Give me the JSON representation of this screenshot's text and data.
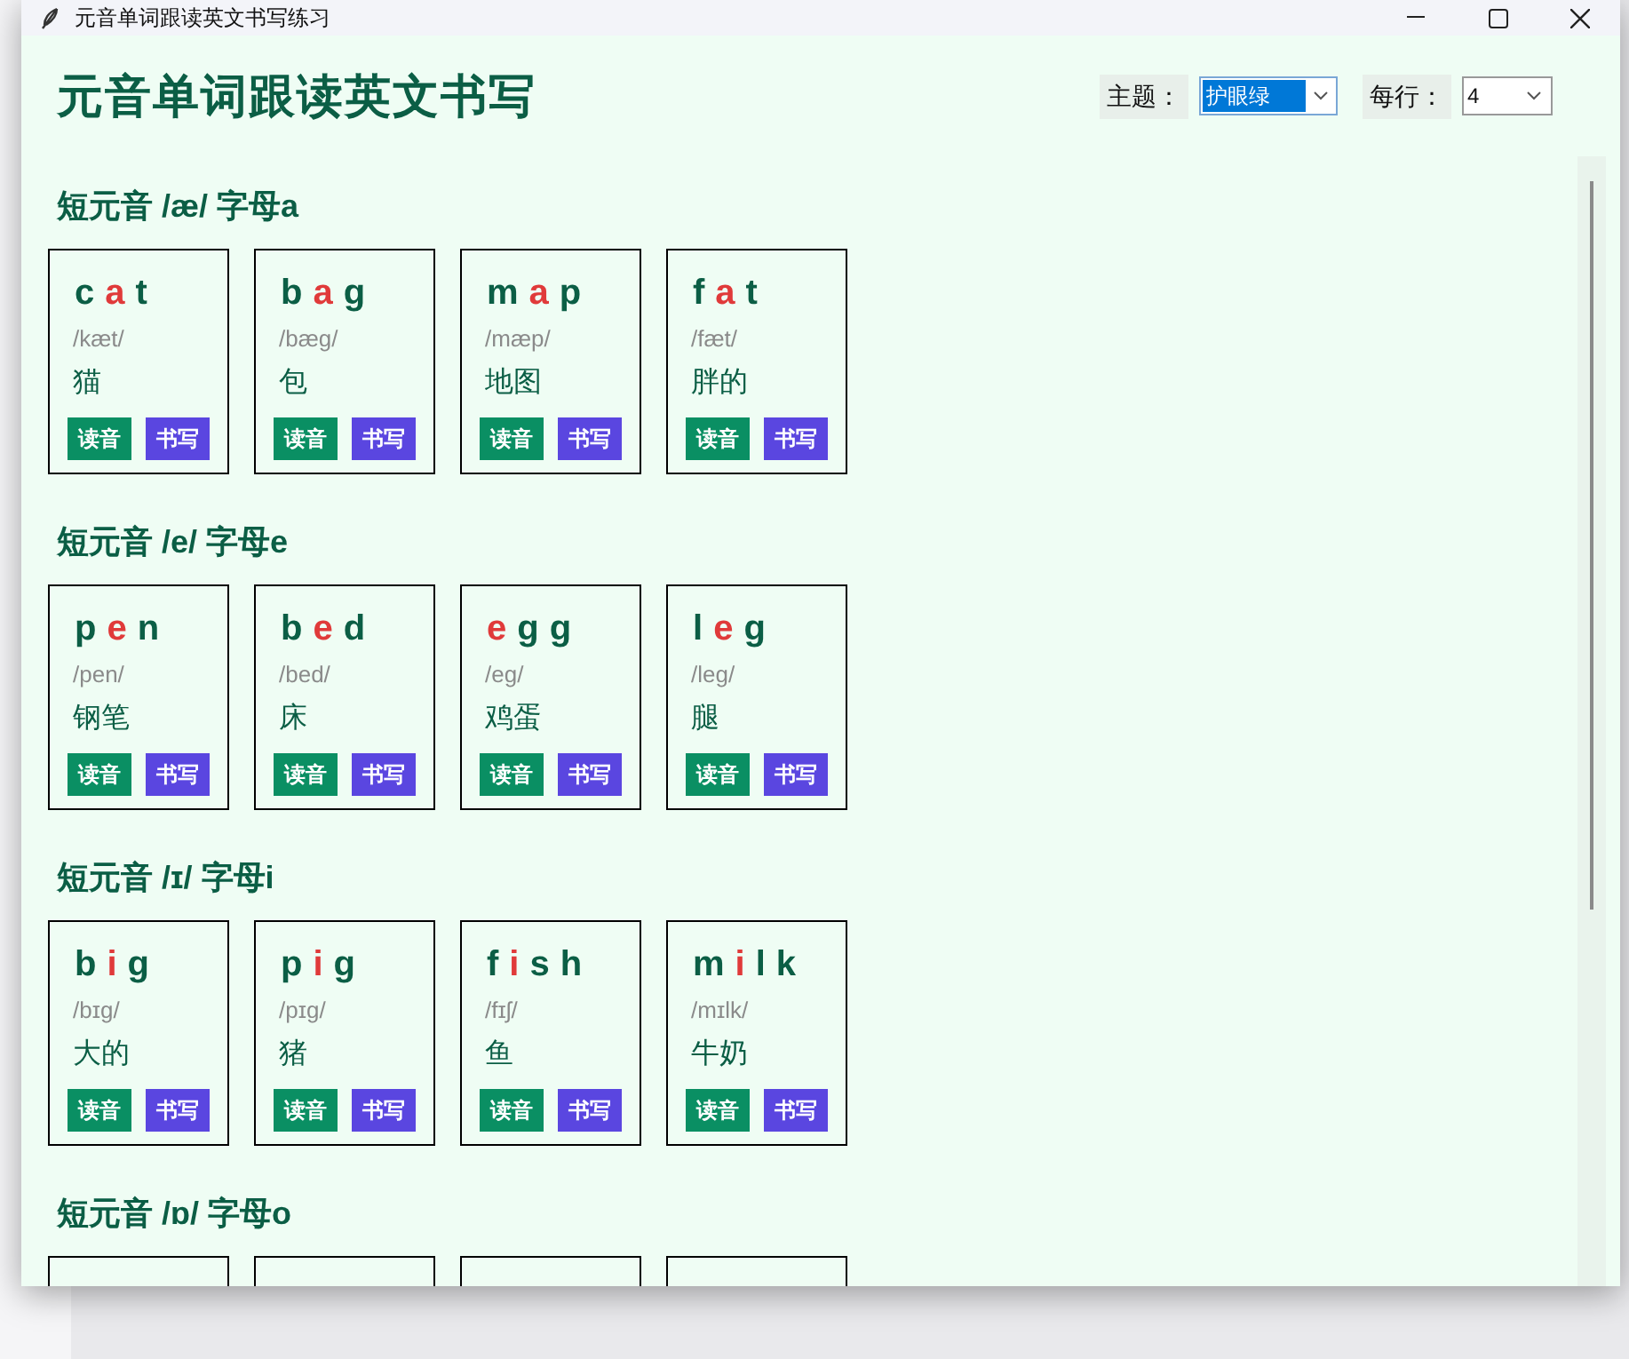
{
  "window": {
    "title": "元音单词跟读英文书写练习"
  },
  "heading": "元音单词跟读英文书写",
  "controls": {
    "theme_label": "主题：",
    "theme_value": "护眼绿",
    "per_row_label": "每行：",
    "per_row_value": "4"
  },
  "sections": [
    {
      "title": "短元音 /æ/ 字母a",
      "cards": [
        {
          "kind": "word",
          "letters": [
            {
              "char": "c",
              "vowel": false
            },
            {
              "char": "a",
              "vowel": true
            },
            {
              "char": "t",
              "vowel": false
            }
          ],
          "phonetic": "/kæt/",
          "meaning": "猫",
          "read_button": "读音",
          "write_button": "书写"
        },
        {
          "kind": "word",
          "letters": [
            {
              "char": "b",
              "vowel": false
            },
            {
              "char": "a",
              "vowel": true
            },
            {
              "char": "g",
              "vowel": false
            }
          ],
          "phonetic": "/bæg/",
          "meaning": "包",
          "read_button": "读音",
          "write_button": "书写"
        },
        {
          "kind": "word",
          "letters": [
            {
              "char": "m",
              "vowel": false
            },
            {
              "char": "a",
              "vowel": true
            },
            {
              "char": "p",
              "vowel": false
            }
          ],
          "phonetic": "/mæp/",
          "meaning": "地图",
          "read_button": "读音",
          "write_button": "书写"
        },
        {
          "kind": "word",
          "letters": [
            {
              "char": "f",
              "vowel": false
            },
            {
              "char": "a",
              "vowel": true
            },
            {
              "char": "t",
              "vowel": false
            }
          ],
          "phonetic": "/fæt/",
          "meaning": "胖的",
          "read_button": "读音",
          "write_button": "书写"
        }
      ]
    },
    {
      "title": "短元音 /e/ 字母e",
      "cards": [
        {
          "kind": "word",
          "letters": [
            {
              "char": "p",
              "vowel": false
            },
            {
              "char": "e",
              "vowel": true
            },
            {
              "char": "n",
              "vowel": false
            }
          ],
          "phonetic": "/pen/",
          "meaning": "钢笔",
          "read_button": "读音",
          "write_button": "书写"
        },
        {
          "kind": "word",
          "letters": [
            {
              "char": "b",
              "vowel": false
            },
            {
              "char": "e",
              "vowel": true
            },
            {
              "char": "d",
              "vowel": false
            }
          ],
          "phonetic": "/bed/",
          "meaning": "床",
          "read_button": "读音",
          "write_button": "书写"
        },
        {
          "kind": "word",
          "letters": [
            {
              "char": "e",
              "vowel": true
            },
            {
              "char": "g",
              "vowel": false
            },
            {
              "char": "g",
              "vowel": false
            }
          ],
          "phonetic": "/eg/",
          "meaning": "鸡蛋",
          "read_button": "读音",
          "write_button": "书写"
        },
        {
          "kind": "word",
          "letters": [
            {
              "char": "l",
              "vowel": false
            },
            {
              "char": "e",
              "vowel": true
            },
            {
              "char": "g",
              "vowel": false
            }
          ],
          "phonetic": "/leg/",
          "meaning": "腿",
          "read_button": "读音",
          "write_button": "书写"
        }
      ]
    },
    {
      "title": "短元音 /ɪ/ 字母i",
      "cards": [
        {
          "kind": "word",
          "letters": [
            {
              "char": "b",
              "vowel": false
            },
            {
              "char": "i",
              "vowel": true
            },
            {
              "char": "g",
              "vowel": false
            }
          ],
          "phonetic": "/bɪg/",
          "meaning": "大的",
          "read_button": "读音",
          "write_button": "书写"
        },
        {
          "kind": "word",
          "letters": [
            {
              "char": "p",
              "vowel": false
            },
            {
              "char": "i",
              "vowel": true
            },
            {
              "char": "g",
              "vowel": false
            }
          ],
          "phonetic": "/pɪg/",
          "meaning": "猪",
          "read_button": "读音",
          "write_button": "书写"
        },
        {
          "kind": "word",
          "letters": [
            {
              "char": "f",
              "vowel": false
            },
            {
              "char": "i",
              "vowel": true
            },
            {
              "char": "s",
              "vowel": false
            },
            {
              "char": "h",
              "vowel": false
            }
          ],
          "phonetic": "/fɪʃ/",
          "meaning": "鱼",
          "read_button": "读音",
          "write_button": "书写"
        },
        {
          "kind": "word",
          "letters": [
            {
              "char": "m",
              "vowel": false
            },
            {
              "char": "i",
              "vowel": true
            },
            {
              "char": "l",
              "vowel": false
            },
            {
              "char": "k",
              "vowel": false
            }
          ],
          "phonetic": "/mɪlk/",
          "meaning": "牛奶",
          "read_button": "读音",
          "write_button": "书写"
        }
      ]
    },
    {
      "title": "短元音 /ɒ/ 字母o",
      "cards": [
        {
          "kind": "cut"
        },
        {
          "kind": "cut"
        },
        {
          "kind": "cut"
        },
        {
          "kind": "cut"
        }
      ]
    }
  ]
}
